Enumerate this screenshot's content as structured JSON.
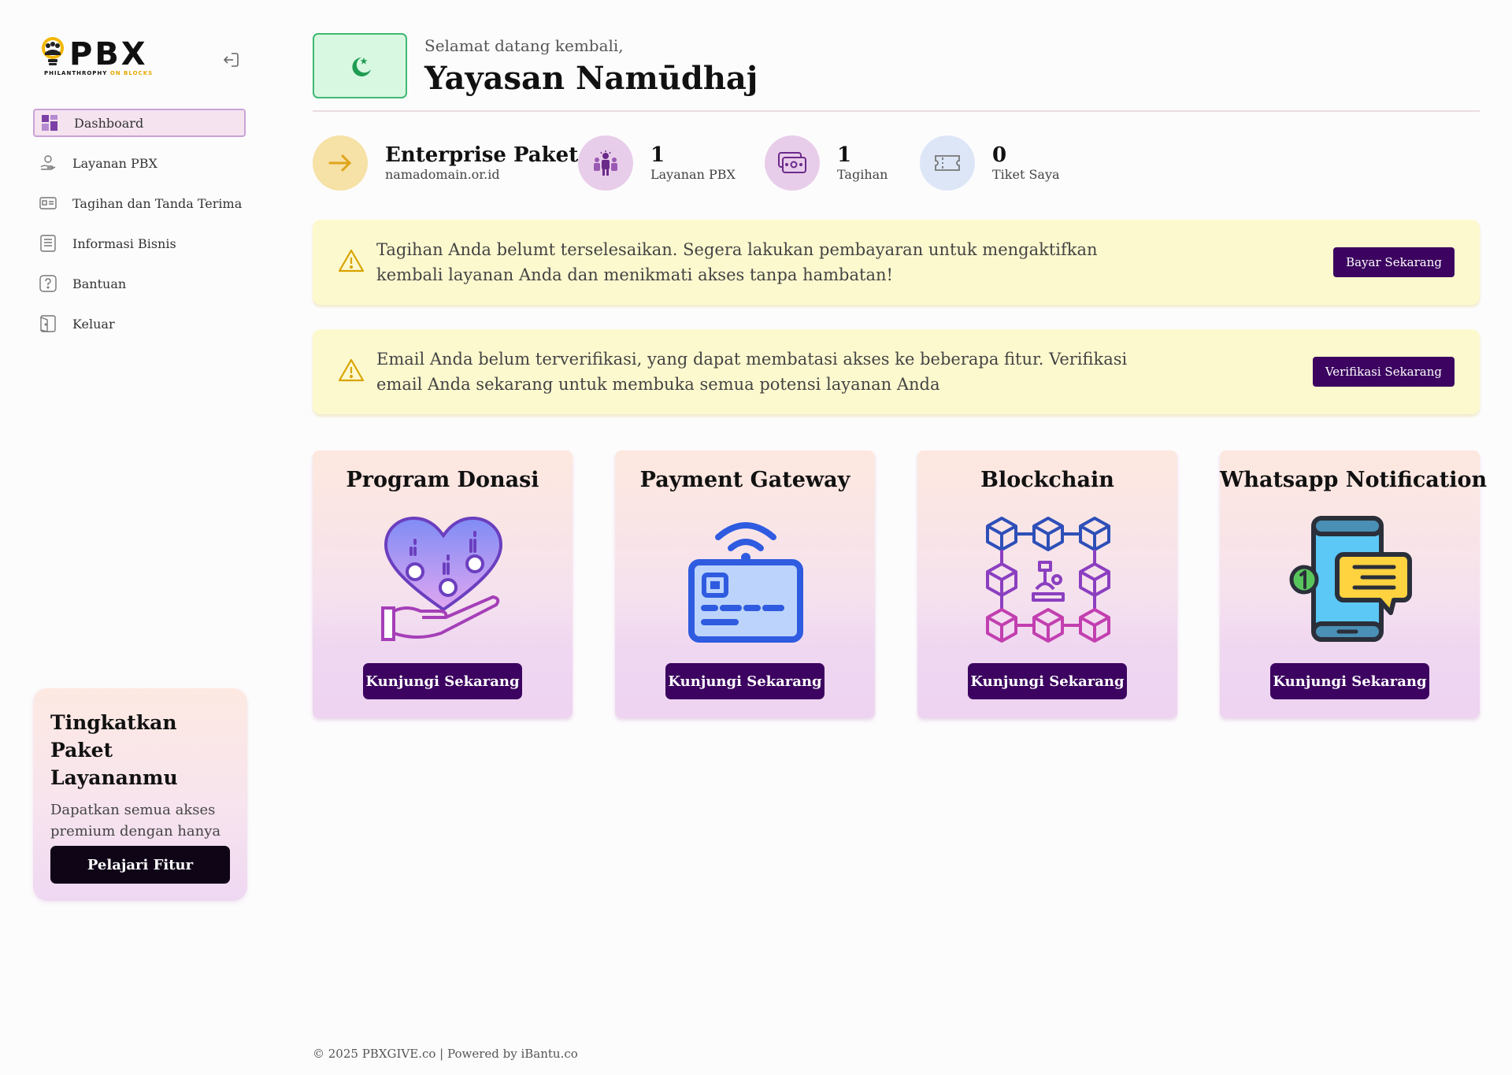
{
  "brand": {
    "logo_text": "PBX",
    "tagline_main": "PHILANTHROPHY",
    "tagline_accent": "ON BLOCKS"
  },
  "sidebar": {
    "items": [
      {
        "label": "Dashboard",
        "icon": "dashboard-icon",
        "active": true
      },
      {
        "label": "Layanan PBX",
        "icon": "hand-coin-icon",
        "active": false
      },
      {
        "label": "Tagihan dan Tanda Terima",
        "icon": "invoice-icon",
        "active": false
      },
      {
        "label": "Informasi Bisnis",
        "icon": "document-list-icon",
        "active": false
      },
      {
        "label": "Bantuan",
        "icon": "help-icon",
        "active": false
      },
      {
        "label": "Keluar",
        "icon": "exit-door-icon",
        "active": false
      }
    ],
    "upgrade": {
      "title": "Tingkatkan Paket Layananmu",
      "description": "Dapatkan semua akses premium dengan hanya sekali pembayaran",
      "button": "Pelajari Fitur"
    }
  },
  "header": {
    "welcome": "Selamat datang kembali,",
    "org_name": "Yayasan Namūdhaj"
  },
  "stats": {
    "package": {
      "title": "Enterprise Paket",
      "domain": "namadomain.or.id"
    },
    "services": {
      "value": "1",
      "label": "Layanan PBX"
    },
    "invoices": {
      "value": "1",
      "label": "Tagihan"
    },
    "tickets": {
      "value": "0",
      "label": "Tiket Saya"
    }
  },
  "alerts": [
    {
      "text": "Tagihan  Anda  belumt terselesaikan. Segera lakukan pembayaran untuk mengaktifkan kembali layanan Anda dan menikmati akses tanpa hambatan!",
      "button": "Bayar Sekarang"
    },
    {
      "text": "Email Anda belum terverifikasi, yang dapat membatasi akses ke beberapa fitur. Verifikasi email Anda sekarang untuk membuka semua potensi layanan Anda",
      "button": "Verifikasi Sekarang"
    }
  ],
  "features": [
    {
      "title": "Program Donasi",
      "button": "Kunjungi Sekarang",
      "icon": "donation-heart-icon"
    },
    {
      "title": "Payment Gateway",
      "button": "Kunjungi Sekarang",
      "icon": "payment-card-icon"
    },
    {
      "title": "Blockchain",
      "button": "Kunjungi Sekarang",
      "icon": "blockchain-icon"
    },
    {
      "title": "Whatsapp Notification",
      "button": "Kunjungi Sekarang",
      "icon": "phone-notification-icon"
    }
  ],
  "footer": {
    "text": "© 2025 PBXGIVE.co |  Powered by iBantu.co"
  },
  "colors": {
    "accent": "#3c0460",
    "alert_bg": "#fdf9cf",
    "active_nav_bg": "#f5e3ef",
    "success": "#3fb871"
  }
}
